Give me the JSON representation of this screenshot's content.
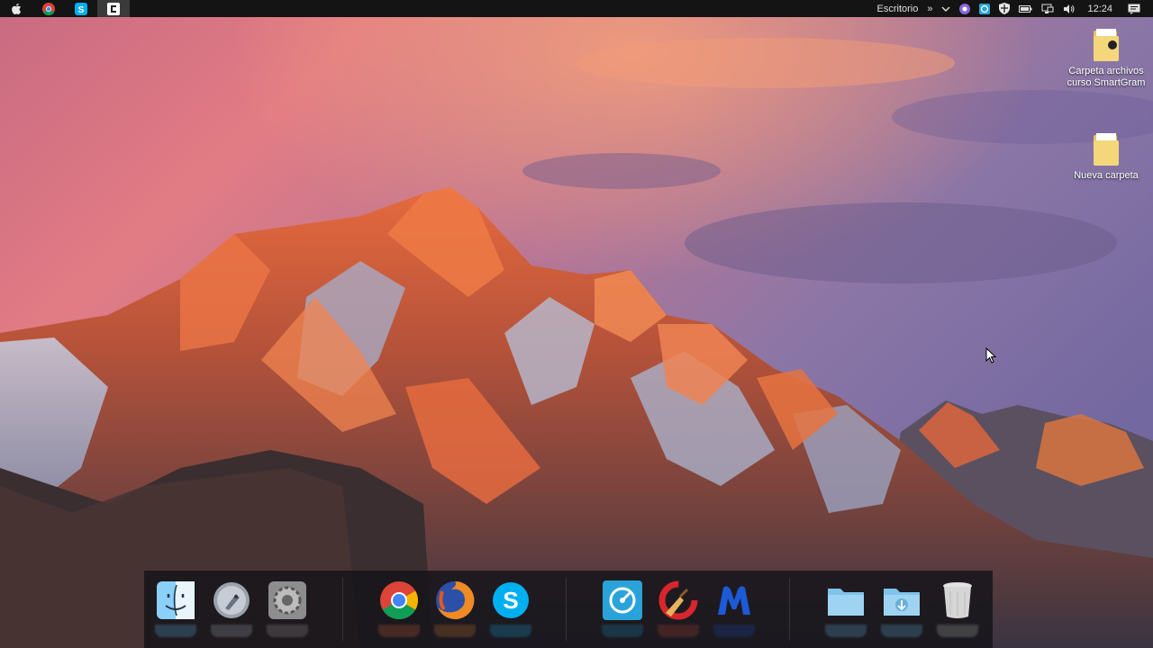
{
  "taskbar": {
    "left_icons": [
      {
        "name": "apple-icon"
      },
      {
        "name": "chrome-icon"
      },
      {
        "name": "skype-icon"
      },
      {
        "name": "camtasia-icon"
      }
    ],
    "desktop_label": "Escritorio",
    "overflow_glyph": "»",
    "clock": "12:24"
  },
  "desktop_icons": [
    {
      "label_line1": "Carpeta archivos",
      "label_line2": "curso SmartGram"
    },
    {
      "label_line1": "Nueva carpeta",
      "label_line2": ""
    }
  ],
  "dock": {
    "items": [
      "finder",
      "launchpad",
      "system-preferences",
      "chrome",
      "firefox",
      "skype",
      "speed-app",
      "ccleaner",
      "malwarebytes",
      "folder",
      "downloads-folder",
      "trash"
    ]
  },
  "colors": {
    "topbar": "#141414",
    "dock_bg": "#141418",
    "sky_pink": "#e57a88",
    "sky_purple": "#7d6fa0"
  }
}
